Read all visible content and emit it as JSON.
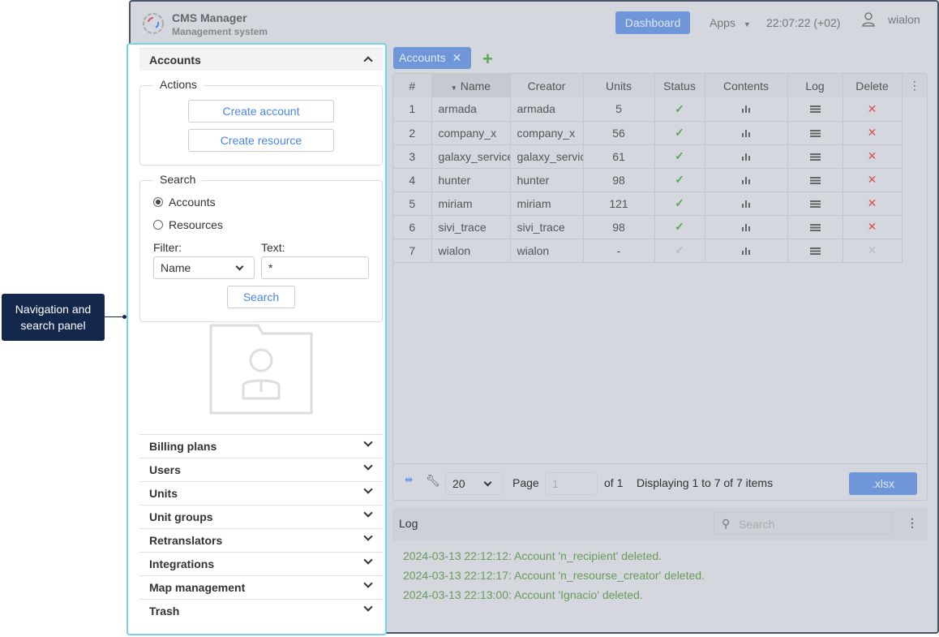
{
  "header": {
    "title": "CMS Manager",
    "subtitle": "Management system",
    "dashboard": "Dashboard",
    "apps": "Apps",
    "clock": "22:07:22 (+02)",
    "user": "wialon"
  },
  "panel": {
    "accounts": "Accounts",
    "actions": "Actions",
    "create_account": "Create account",
    "create_resource": "Create resource",
    "search_legend": "Search",
    "radio_accounts": "Accounts",
    "radio_resources": "Resources",
    "filter_label": "Filter:",
    "filter_value": "Name",
    "text_label": "Text:",
    "text_value": "*",
    "search_button": "Search",
    "sections": [
      "Billing plans",
      "Users",
      "Units",
      "Unit groups",
      "Retranslators",
      "Integrations",
      "Map management",
      "Trash"
    ]
  },
  "tab": {
    "label": "Accounts"
  },
  "table": {
    "columns": [
      "#",
      "Name",
      "Creator",
      "Units",
      "Status",
      "Contents",
      "Log",
      "Delete"
    ],
    "rows": [
      {
        "n": "1",
        "name": "armada",
        "creator": "armada",
        "units": "5",
        "active": true
      },
      {
        "n": "2",
        "name": "company_x",
        "creator": "company_x",
        "units": "56",
        "active": true
      },
      {
        "n": "3",
        "name": "galaxy_service",
        "creator": "galaxy_service",
        "units": "61",
        "active": true
      },
      {
        "n": "4",
        "name": "hunter",
        "creator": "hunter",
        "units": "98",
        "active": true
      },
      {
        "n": "5",
        "name": "miriam",
        "creator": "miriam",
        "units": "121",
        "active": true
      },
      {
        "n": "6",
        "name": "sivi_trace",
        "creator": "sivi_trace",
        "units": "98",
        "active": true
      },
      {
        "n": "7",
        "name": "wialon",
        "creator": "wialon",
        "units": "-",
        "active": false
      }
    ]
  },
  "pager": {
    "page_size": "20",
    "page_label": "Page",
    "page_value": "1",
    "of": "of 1",
    "display": "Displaying 1 to 7 of 7 items",
    "export": ".xlsx"
  },
  "log": {
    "title": "Log",
    "search_placeholder": "Search",
    "lines": [
      "2024-03-13 22:12:12: Account 'n_recipient' deleted.",
      "2024-03-13 22:12:17: Account 'n_resourse_creator' deleted.",
      "2024-03-13 22:13:00: Account 'Ignacio' deleted."
    ]
  },
  "callout": {
    "text": "Navigation and search panel"
  },
  "colors": {
    "accent": "#6e96d9",
    "highlight": "#74d4e8",
    "callout": "#14284b",
    "ok": "#5aa65a",
    "delete": "#d9534f"
  }
}
